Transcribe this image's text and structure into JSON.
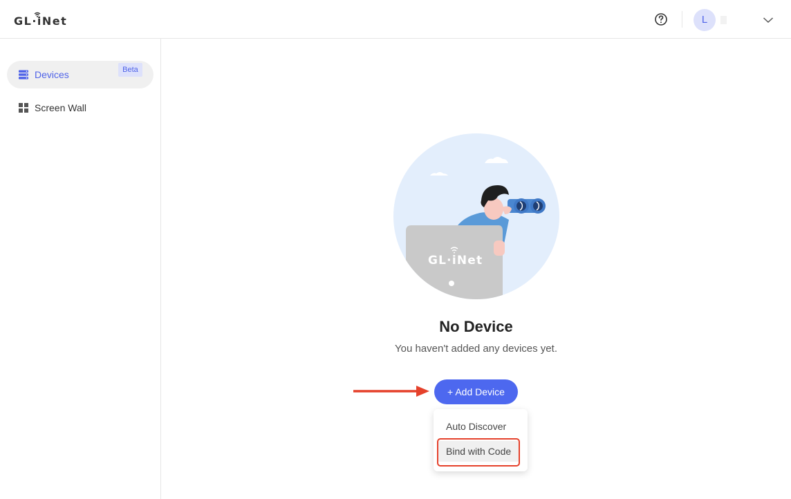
{
  "header": {
    "logo_text": "GL·iNet",
    "avatar_letter": "L"
  },
  "sidebar": {
    "items": [
      {
        "label": "Devices",
        "icon": "devices-icon",
        "active": true
      },
      {
        "label": "Screen Wall",
        "icon": "grid-icon",
        "badge": "Beta"
      }
    ]
  },
  "main": {
    "illustration_logo": "GL·iNet",
    "empty_title": "No Device",
    "empty_desc": "You haven't added any devices yet.",
    "add_button": "+ Add Device",
    "dropdown": {
      "items": [
        "Auto Discover",
        "Bind with Code"
      ]
    }
  },
  "colors": {
    "accent": "#4d68ef",
    "annotation": "#e5412b"
  }
}
